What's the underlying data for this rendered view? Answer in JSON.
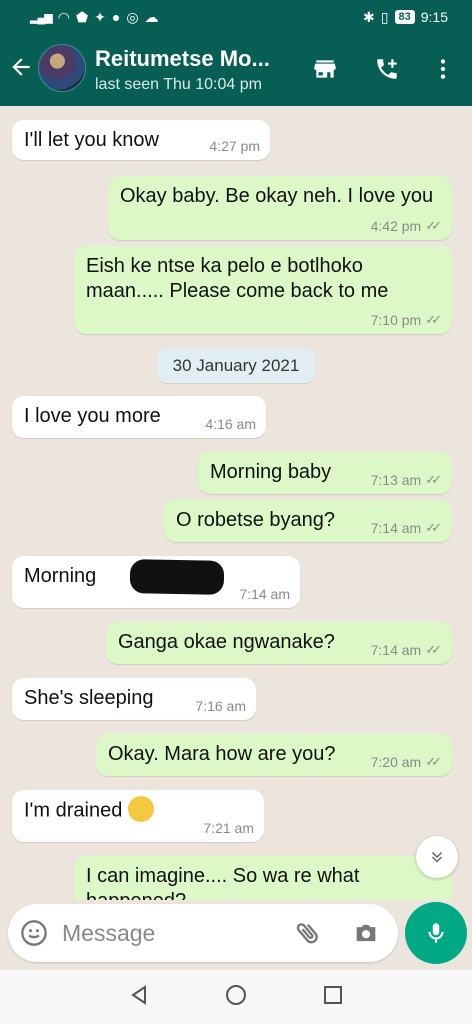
{
  "status": {
    "time": "9:15",
    "battery": "83",
    "signal": "4G"
  },
  "header": {
    "contact_name": "Reitumetse Mo...",
    "last_seen": "last seen Thu 10:04 pm"
  },
  "messages": [
    {
      "dir": "in",
      "text": "I'll let you know",
      "time": "4:27 pm"
    },
    {
      "dir": "out",
      "text": "Okay baby. Be okay neh. I love you",
      "time": "4:42 pm"
    },
    {
      "dir": "out",
      "text": "Eish ke ntse ka pelo e botlhoko maan..... Please come back to me",
      "time": "7:10 pm"
    },
    {
      "dir": "in",
      "text": "I love you more",
      "time": "4:16 am"
    },
    {
      "dir": "out",
      "text": "Morning baby",
      "time": "7:13 am"
    },
    {
      "dir": "out",
      "text": "O robetse byang?",
      "time": "7:14 am"
    },
    {
      "dir": "in",
      "text": "Morning",
      "time": "7:14 am"
    },
    {
      "dir": "out",
      "text": "Ganga okae ngwanake?",
      "time": "7:14 am"
    },
    {
      "dir": "in",
      "text": "She's sleeping",
      "time": "7:16 am"
    },
    {
      "dir": "out",
      "text": "Okay. Mara how are you?",
      "time": "7:20 am"
    },
    {
      "dir": "in",
      "text": "I'm drained",
      "time": "7:21 am"
    },
    {
      "dir": "out",
      "text": "I can imagine.... So wa re what happened? ...",
      "time": ""
    }
  ],
  "date_chip": "30 January 2021",
  "composer": {
    "placeholder": "Message"
  },
  "colors": {
    "header": "#075e54",
    "outgoing": "#dcf8c6",
    "incoming": "#ffffff",
    "mic": "#00a884",
    "chat_bg": "#ece5dd"
  },
  "icons": [
    "back-arrow-icon",
    "shop-icon",
    "add-call-icon",
    "more-vert-icon",
    "emoji-icon",
    "attach-icon",
    "camera-icon",
    "mic-icon",
    "scroll-down-icon",
    "nav-back-icon",
    "nav-home-icon",
    "nav-recents-icon"
  ]
}
